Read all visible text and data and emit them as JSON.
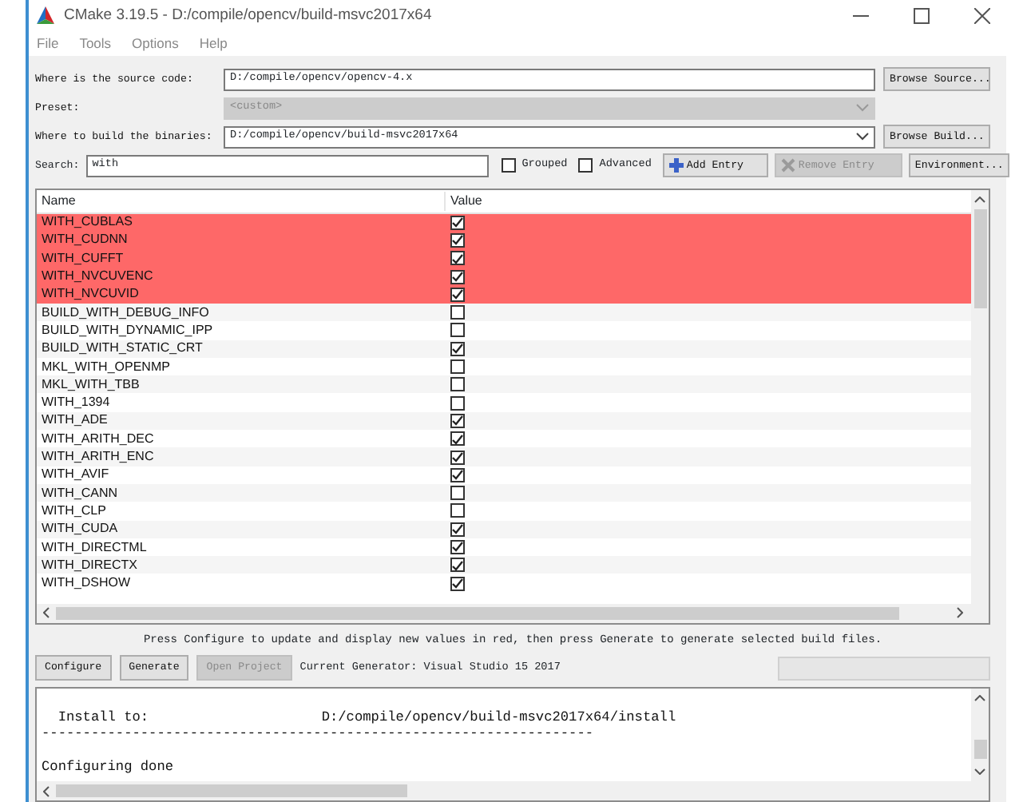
{
  "window": {
    "title": "CMake 3.19.5 - D:/compile/opencv/build-msvc2017x64"
  },
  "menu": [
    "File",
    "Tools",
    "Options",
    "Help"
  ],
  "source": {
    "label": "Where is the source code:",
    "value": "D:/compile/opencv/opencv-4.x",
    "button": "Browse Source..."
  },
  "preset": {
    "label": "Preset:",
    "value": "<custom>",
    "disabled": true
  },
  "build": {
    "label": "Where to build the binaries:",
    "value": "D:/compile/opencv/build-msvc2017x64",
    "button": "Browse Build..."
  },
  "search": {
    "label": "Search:",
    "value": "with"
  },
  "options": [
    {
      "label": "Grouped",
      "checked": false
    },
    {
      "label": "Advanced",
      "checked": false
    }
  ],
  "toolbar": [
    {
      "label": "Add Entry",
      "kind": "add",
      "disabled": false
    },
    {
      "label": "Remove Entry",
      "kind": "remove",
      "disabled": true
    },
    {
      "label": "Environment...",
      "kind": "plain",
      "disabled": false
    }
  ],
  "table": {
    "columns": [
      "Name",
      "Value"
    ],
    "rows": [
      {
        "name": "WITH_CUBLAS",
        "checked": true,
        "changed": true
      },
      {
        "name": "WITH_CUDNN",
        "checked": true,
        "changed": true
      },
      {
        "name": "WITH_CUFFT",
        "checked": true,
        "changed": true
      },
      {
        "name": "WITH_NVCUVENC",
        "checked": true,
        "changed": true
      },
      {
        "name": "WITH_NVCUVID",
        "checked": true,
        "changed": true
      },
      {
        "name": "BUILD_WITH_DEBUG_INFO",
        "checked": false,
        "changed": false
      },
      {
        "name": "BUILD_WITH_DYNAMIC_IPP",
        "checked": false,
        "changed": false
      },
      {
        "name": "BUILD_WITH_STATIC_CRT",
        "checked": true,
        "changed": false
      },
      {
        "name": "MKL_WITH_OPENMP",
        "checked": false,
        "changed": false
      },
      {
        "name": "MKL_WITH_TBB",
        "checked": false,
        "changed": false
      },
      {
        "name": "WITH_1394",
        "checked": false,
        "changed": false
      },
      {
        "name": "WITH_ADE",
        "checked": true,
        "changed": false
      },
      {
        "name": "WITH_ARITH_DEC",
        "checked": true,
        "changed": false
      },
      {
        "name": "WITH_ARITH_ENC",
        "checked": true,
        "changed": false
      },
      {
        "name": "WITH_AVIF",
        "checked": true,
        "changed": false
      },
      {
        "name": "WITH_CANN",
        "checked": false,
        "changed": false
      },
      {
        "name": "WITH_CLP",
        "checked": false,
        "changed": false
      },
      {
        "name": "WITH_CUDA",
        "checked": true,
        "changed": false
      },
      {
        "name": "WITH_DIRECTML",
        "checked": true,
        "changed": false
      },
      {
        "name": "WITH_DIRECTX",
        "checked": true,
        "changed": false
      },
      {
        "name": "WITH_DSHOW",
        "checked": true,
        "changed": false
      }
    ]
  },
  "hint": "Press Configure to update and display new values in red, then press Generate to generate selected build files.",
  "actions": [
    {
      "label": "Configure",
      "disabled": false
    },
    {
      "label": "Generate",
      "disabled": false
    },
    {
      "label": "Open Project",
      "disabled": true
    }
  ],
  "generator": "Current Generator: Visual Studio 15 2017",
  "progress": {
    "level": 0
  },
  "log": {
    "lines": [
      {
        "text": "  Install to:                     D:/compile/opencv/build-msvc2017x64/install",
        "blank_before": true
      },
      {
        "text": "-------------------------------------------------------------------",
        "blank_before": false
      },
      {
        "text": "Configuring done",
        "blank_before": true
      }
    ]
  }
}
